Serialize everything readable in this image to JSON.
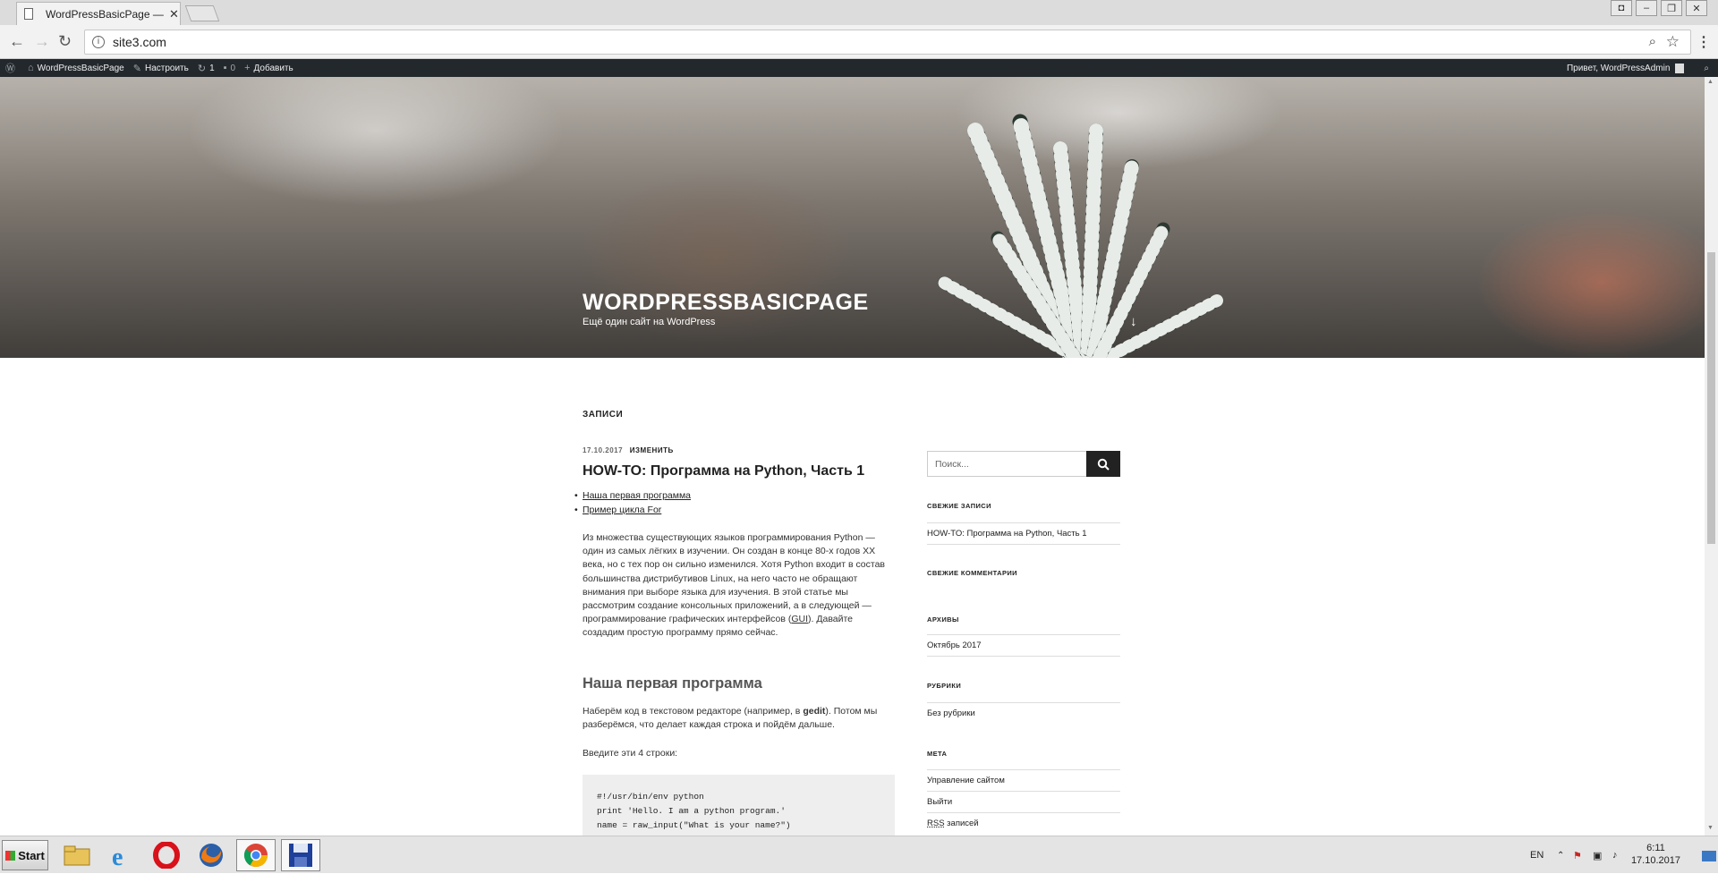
{
  "browser": {
    "tab_title": "WordPressBasicPage — Eu",
    "url": "site3.com"
  },
  "adminbar": {
    "site_name": "WordPressBasicPage",
    "customize": "Настроить",
    "updates_count": "1",
    "comments_count": "0",
    "add_new": "Добавить",
    "greeting": "Привет, WordPressAdmin"
  },
  "header": {
    "site_title": "WORDPRESSBASICPAGE",
    "site_description": "Ещё один сайт на WordPress"
  },
  "content": {
    "page_heading": "ЗАПИСИ",
    "post_date": "17.10.2017",
    "post_edit": "ИЗМЕНИТЬ",
    "post_title": "HOW-TO: Программа на Python, Часть 1",
    "toc": [
      "Наша первая программа",
      "Пример цикла For"
    ],
    "intro_pre": "Из множества существующих языков программирования Python — один из самых лёгких в изучении. Он создан в конце 80-х годов XX века, но с тех пор он сильно изменился. Хотя Python входит в состав большинства дистрибутивов Linux, на него часто не обращают внимания при выборе языка для изучения. В этой статье мы рассмотрим создание консольных приложений, а в следующей — программирование графических интерфейсов (",
    "intro_gui": "GUI",
    "intro_post": "). Давайте создадим простую программу прямо сейчас.",
    "section_heading": "Наша первая программа",
    "para1_pre": "Наберём код в текстовом редакторе (например, в ",
    "para1_bold": "gedit",
    "para1_post": "). Потом мы разберёмся, что делает каждая строка и пойдём дальше.",
    "para2": "Введите эти 4 строки:",
    "code": "#!/usr/bin/env python\nprint 'Hello. I am a python program.'\nname = raw_input(\"What is your name?\")"
  },
  "sidebar": {
    "search_placeholder": "Поиск...",
    "recent_posts_title": "СВЕЖИЕ ЗАПИСИ",
    "recent_posts": [
      "HOW-TO: Программа на Python, Часть 1"
    ],
    "recent_comments_title": "СВЕЖИЕ КОММЕНТАРИИ",
    "archives_title": "АРХИВЫ",
    "archives": [
      "Октябрь 2017"
    ],
    "categories_title": "РУБРИКИ",
    "categories": [
      "Без рубрики"
    ],
    "meta_title": "МЕТА",
    "meta": [
      "Управление сайтом",
      "Выйти"
    ],
    "meta_rss_abbr": "RSS",
    "meta_rss_rest": " записей"
  },
  "taskbar": {
    "start_label": "Start",
    "language": "EN",
    "time": "6:11",
    "date": "17.10.2017"
  }
}
